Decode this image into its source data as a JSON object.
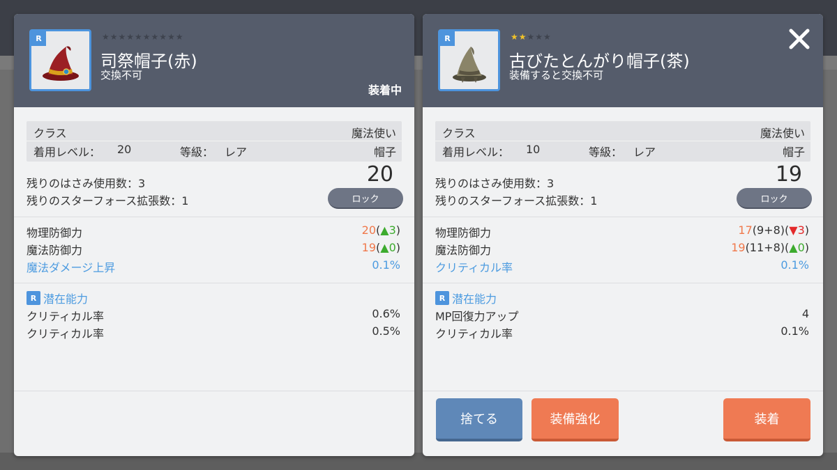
{
  "left_item": {
    "rarity": "R",
    "stars": "★★★★★★★★★★",
    "name": "司祭帽子(赤)",
    "trade_note": "交換不可",
    "equipped_label": "装着中",
    "class_label": "クラス",
    "class_value": "魔法使い",
    "level_label": "着用レベル：",
    "level_value": "20",
    "grade_label": "等級：",
    "grade_value": "レア",
    "type_value": "帽子",
    "scissors_label": "残りのはさみ使用数：3",
    "starforce_label": "残りのスターフォース拡張数：1",
    "big_number": "20",
    "lock_label": "ロック",
    "stats": [
      {
        "label": "物理防御力",
        "value": "20",
        "base": "",
        "delta_open": "(",
        "arrow": "▲",
        "delta": "3",
        "delta_close": ")"
      },
      {
        "label": "魔法防御力",
        "value": "19",
        "base": "",
        "delta_open": "(",
        "arrow": "▲",
        "delta": "0",
        "delta_close": ")"
      },
      {
        "label": "魔法ダメージ上昇",
        "value": "0.1%"
      }
    ],
    "potential_title": "潜在能力",
    "potential_badge": "R",
    "potentials": [
      {
        "label": "クリティカル率",
        "value": "0.6%"
      },
      {
        "label": "クリティカル率",
        "value": "0.5%"
      }
    ]
  },
  "right_item": {
    "rarity": "R",
    "stars_on": "★★",
    "stars_off": "★★★",
    "name": "古びたとんがり帽子(茶)",
    "trade_note": "装備すると交換不可",
    "class_label": "クラス",
    "class_value": "魔法使い",
    "level_label": "着用レベル：",
    "level_value": "10",
    "grade_label": "等級：",
    "grade_value": "レア",
    "type_value": "帽子",
    "scissors_label": "残りのはさみ使用数：3",
    "starforce_label": "残りのスターフォース拡張数：1",
    "big_number": "19",
    "lock_label": "ロック",
    "stats": [
      {
        "label": "物理防御力",
        "value": "17",
        "base": "(9+8)",
        "delta_open": "(",
        "arrow": "▼",
        "delta": "3",
        "delta_close": ")"
      },
      {
        "label": "魔法防御力",
        "value": "19",
        "base": "(11+8)",
        "delta_open": "(",
        "arrow": "▲",
        "delta": "0",
        "delta_close": ")"
      },
      {
        "label": "クリティカル率",
        "value": "0.1%"
      }
    ],
    "potential_title": "潜在能力",
    "potential_badge": "R",
    "potentials": [
      {
        "label": "MP回復力アップ",
        "value": "4"
      },
      {
        "label": "クリティカル率",
        "value": "0.1%"
      }
    ],
    "buttons": {
      "discard": "捨てる",
      "enhance": "装備強化",
      "equip": "装着"
    }
  },
  "colors": {
    "header": "#555c6b",
    "panel": "#f1f2f3",
    "accent_blue": "#4d94dd",
    "stat_orange": "#f0784a",
    "up_green": "#3dab2e",
    "down_red": "#e3292a",
    "button_blue": "#5f88b8",
    "button_orange": "#ef7a53"
  },
  "icons": {
    "left_item": "red-wizard-hat-icon",
    "right_item": "brown-pointy-hat-icon",
    "close": "close-icon"
  }
}
